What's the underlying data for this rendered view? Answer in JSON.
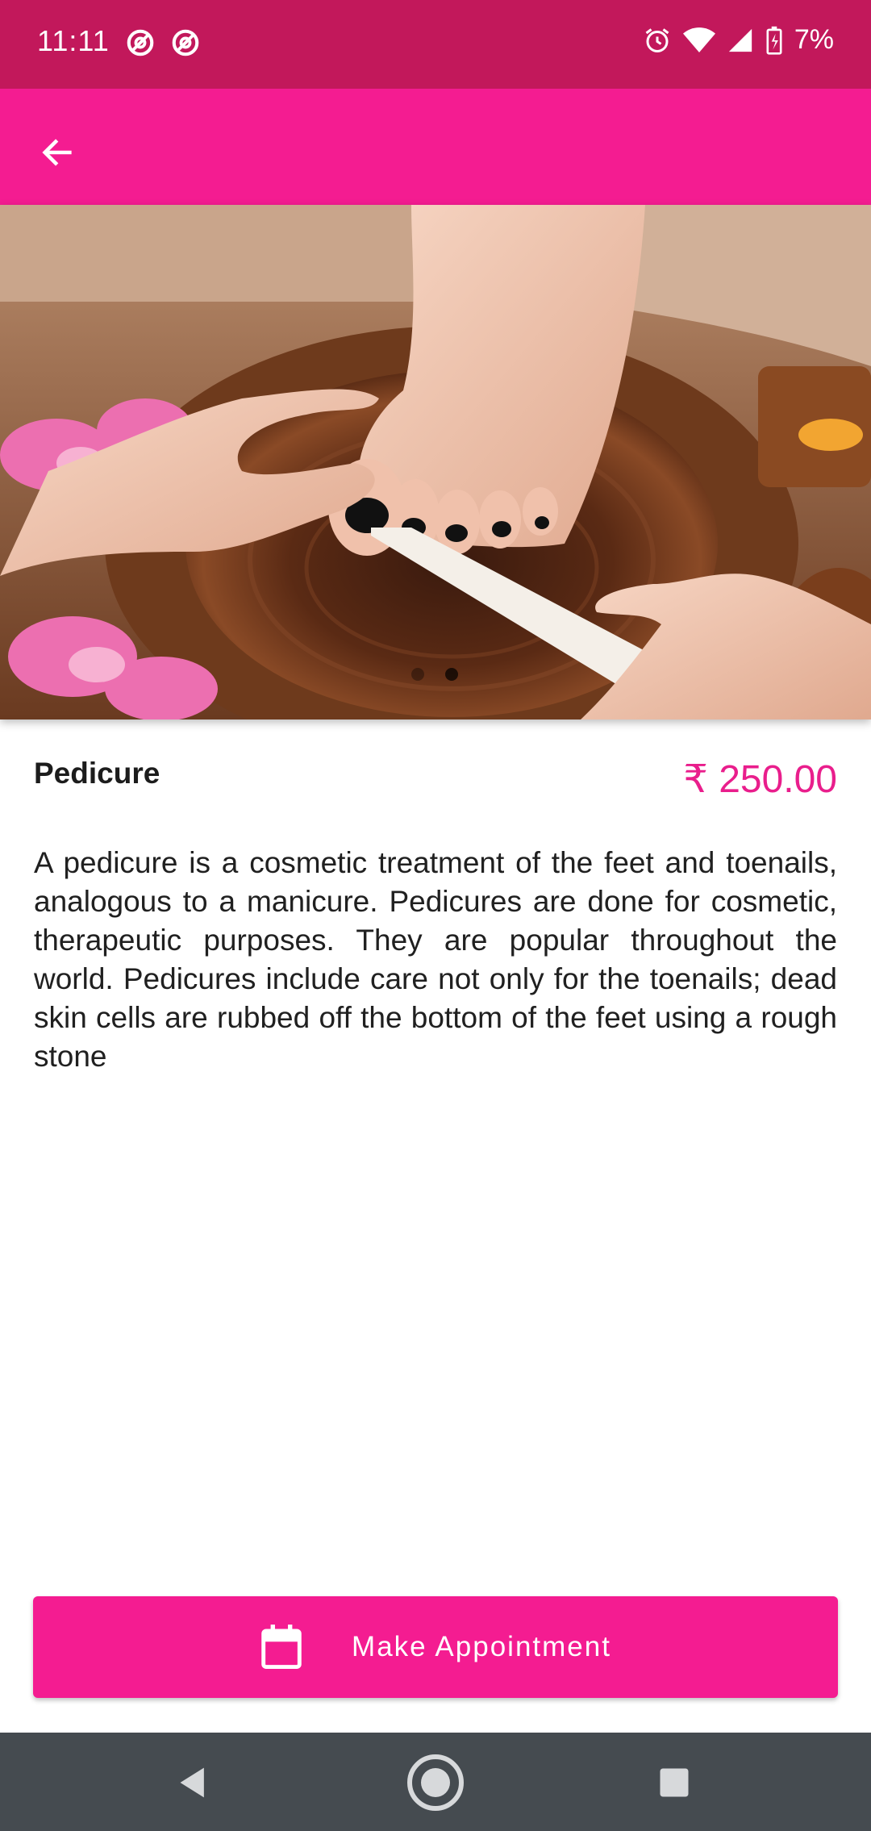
{
  "status_bar": {
    "time": "11:11",
    "battery_percent": "7%",
    "icons": [
      "at-sign-icon",
      "at-sign-icon",
      "alarm-icon",
      "wifi-icon",
      "signal-icon",
      "battery-charging-icon"
    ]
  },
  "app_bar": {
    "back_icon": "arrow-back-icon"
  },
  "hero": {
    "carousel_indicator": {
      "count": 2,
      "active": 1
    }
  },
  "service": {
    "name": "Pedicure",
    "price": "₹ 250.00",
    "description": "A pedicure is a cosmetic treatment of the feet and toenails, analogous to a manicure. Pedicures are done for cosmetic, therapeutic purposes. They are popular throughout the world. Pedicures include care not only for the toenails; dead skin cells are rubbed off the bottom of the feet using a rough stone"
  },
  "cta": {
    "label": "Make Appointment",
    "icon": "calendar-icon"
  },
  "nav_bar": {
    "icons": [
      "back-triangle-icon",
      "home-circle-icon",
      "recents-square-icon"
    ]
  },
  "colors": {
    "status_bar": "#c2185b",
    "accent": "#f41c91",
    "price": "#e91e8c",
    "nav_bar": "#454b50"
  }
}
